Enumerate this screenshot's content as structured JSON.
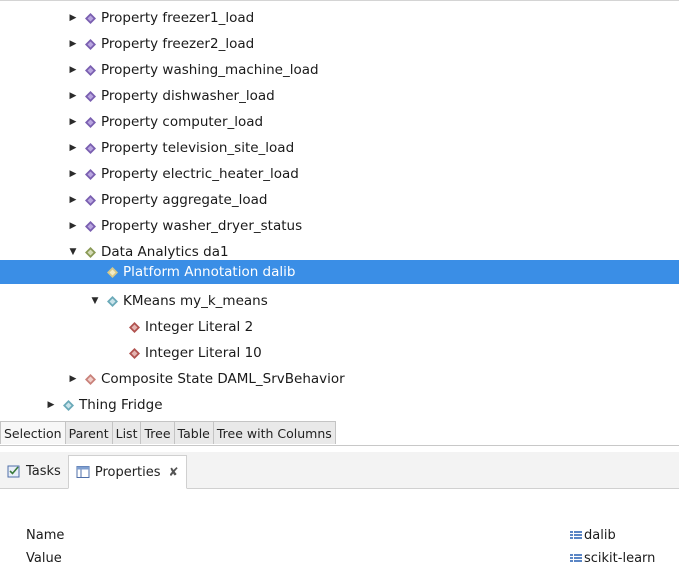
{
  "tree": {
    "items": [
      {
        "label": "Property freezer1_load",
        "icon": "property-icon",
        "twisty": "collapsed",
        "color": "#7a5fb0"
      },
      {
        "label": "Property freezer2_load",
        "icon": "property-icon",
        "twisty": "collapsed",
        "color": "#7a5fb0"
      },
      {
        "label": "Property washing_machine_load",
        "icon": "property-icon",
        "twisty": "collapsed",
        "color": "#7a5fb0"
      },
      {
        "label": "Property dishwasher_load",
        "icon": "property-icon",
        "twisty": "collapsed",
        "color": "#7a5fb0"
      },
      {
        "label": "Property computer_load",
        "icon": "property-icon",
        "twisty": "collapsed",
        "color": "#7a5fb0"
      },
      {
        "label": "Property television_site_load",
        "icon": "property-icon",
        "twisty": "collapsed",
        "color": "#7a5fb0"
      },
      {
        "label": "Property electric_heater_load",
        "icon": "property-icon",
        "twisty": "collapsed",
        "color": "#7a5fb0"
      },
      {
        "label": "Property aggregate_load",
        "icon": "property-icon",
        "twisty": "collapsed",
        "color": "#7a5fb0"
      },
      {
        "label": "Property washer_dryer_status",
        "icon": "property-icon",
        "twisty": "collapsed",
        "color": "#7a5fb0"
      },
      {
        "label": "Data Analytics da1",
        "icon": "data-analytics-icon",
        "twisty": "expanded",
        "color": "#8a9a55"
      },
      {
        "label": "Platform Annotation dalib",
        "icon": "annotation-icon",
        "twisty": "none",
        "color": "#d7c98a",
        "selected": true
      },
      {
        "label": "KMeans my_k_means",
        "icon": "kmeans-icon",
        "twisty": "expanded",
        "color": "#6aa9b8"
      },
      {
        "label": "Integer Literal 2",
        "icon": "literal-icon",
        "twisty": "none",
        "color": "#b0524f"
      },
      {
        "label": "Integer Literal 10",
        "icon": "literal-icon",
        "twisty": "none",
        "color": "#b0524f"
      },
      {
        "label": "Composite State DAML_SrvBehavior",
        "icon": "composite-state-icon",
        "twisty": "collapsed",
        "color": "#c9817a"
      },
      {
        "label": "Thing Fridge",
        "icon": "thing-icon",
        "twisty": "collapsed",
        "color": "#6aa9b8"
      }
    ]
  },
  "editor_tabs": [
    {
      "label": "Selection",
      "active": true
    },
    {
      "label": "Parent"
    },
    {
      "label": "List"
    },
    {
      "label": "Tree"
    },
    {
      "label": "Table"
    },
    {
      "label": "Tree with Columns"
    }
  ],
  "view_tabs": {
    "tasks_label": "Tasks",
    "properties_label": "Properties",
    "close_glyph": "✘"
  },
  "properties": [
    {
      "name": "Name",
      "value": "dalib"
    },
    {
      "name": "Value",
      "value": "scikit-learn"
    }
  ],
  "colors": {
    "selection": "#3a8ee6",
    "value_icon": "#5b86c5"
  }
}
